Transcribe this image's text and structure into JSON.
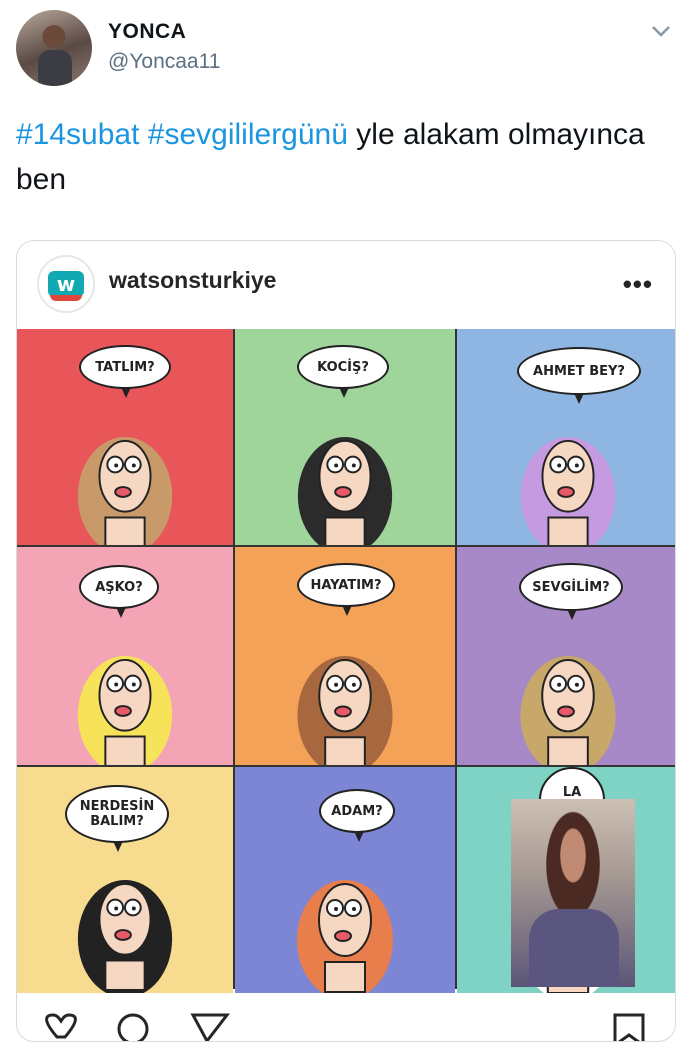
{
  "tweet": {
    "display_name": "YONCA",
    "handle": "@Yoncaa11",
    "hashtag1": "#14subat",
    "hashtag2": "#sevgilileргünü",
    "text_rest": " yle alakam olmayınca ben"
  },
  "embed": {
    "account": "watsonsturkiye",
    "logo_letter": "w",
    "menu": "•••"
  },
  "panels": [
    {
      "label": "TATLIM?",
      "bg": "#e9565a"
    },
    {
      "label": "KOCİŞ?",
      "bg": "#9fd49b"
    },
    {
      "label": "AHMET BEY?",
      "bg": "#8fb6e3"
    },
    {
      "label": "AŞKO?",
      "bg": "#f3a5b6"
    },
    {
      "label": "HAYATIM?",
      "bg": "#f4a257"
    },
    {
      "label": "SEVGİLİM?",
      "bg": "#a889c8"
    },
    {
      "label": "NERDESİN BALIM?",
      "bg": "#f7dc8f"
    },
    {
      "label": "ADAM?",
      "bg": "#7c86d4"
    },
    {
      "label": "LA BEBE?",
      "bg": "#7fd3c4"
    }
  ],
  "colors": {
    "hashtag": "#1b95e0",
    "handle": "#5b7083"
  }
}
